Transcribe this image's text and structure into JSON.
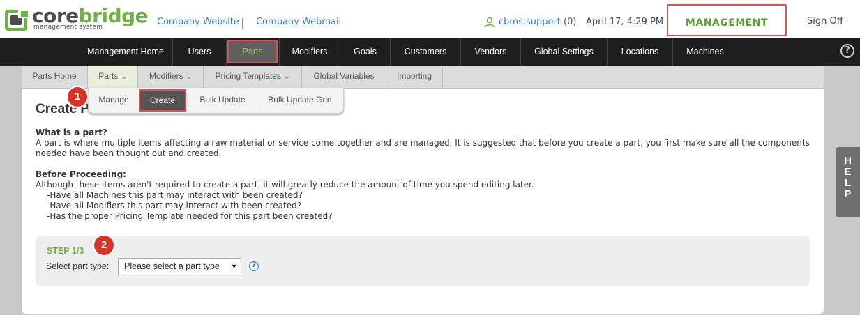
{
  "logo": {
    "word_a": "core",
    "word_b": "bridge",
    "sub": "management system",
    "accent": "#6db33f"
  },
  "header": {
    "company_website": "Company Website",
    "company_webmail": "Company Webmail",
    "user": "cbms.support",
    "user_count": "(0)",
    "datetime": "April 17, 4:29 PM",
    "management": "MANAGEMENT",
    "sign_off": "Sign Off"
  },
  "mainnav": {
    "items": [
      "Management Home",
      "Users",
      "Parts",
      "Modifiers",
      "Goals",
      "Customers",
      "Vendors",
      "Global Settings",
      "Locations",
      "Machines"
    ],
    "help_icon": "?"
  },
  "subnav": {
    "items": [
      "Parts Home",
      "Parts",
      "Modifiers",
      "Pricing Templates",
      "Global Variables",
      "Importing"
    ],
    "chevron": "❯"
  },
  "dropdown": {
    "items": [
      "Manage",
      "Create",
      "Bulk Update",
      "Bulk Update Grid"
    ]
  },
  "badges": [
    "1",
    "2"
  ],
  "content": {
    "title": "Create Part",
    "what_heading": "What is a part?",
    "what_body_line1": "A part is where multiple items affecting a raw material or service come together and are managed. It is suggested that before you create a part, you first make sure all the components",
    "what_body_line2": "needed have been thought out and created.",
    "before_heading": "Before Proceeding:",
    "before_body": "Although these items aren't required to create a part, it will greatly reduce the amount of time you spend editing later.",
    "bullets": [
      "-Have all Machines this part may interact with been created?",
      "-Have all Modifiers this part may interact with been created?",
      "-Has the proper Pricing Template needed for this part been created?"
    ]
  },
  "step": {
    "label": "STEP 1/3",
    "select_label": "Select part type:",
    "select_value": "Please select a part type",
    "arrow": "▼",
    "help": "?"
  },
  "help_tab": {
    "letters": [
      "H",
      "E",
      "L",
      "P"
    ]
  },
  "colors": {
    "highlight": "#e05050",
    "green": "#6db33f",
    "link": "#3a7fbf",
    "nav_bg": "#1e1e1e"
  }
}
